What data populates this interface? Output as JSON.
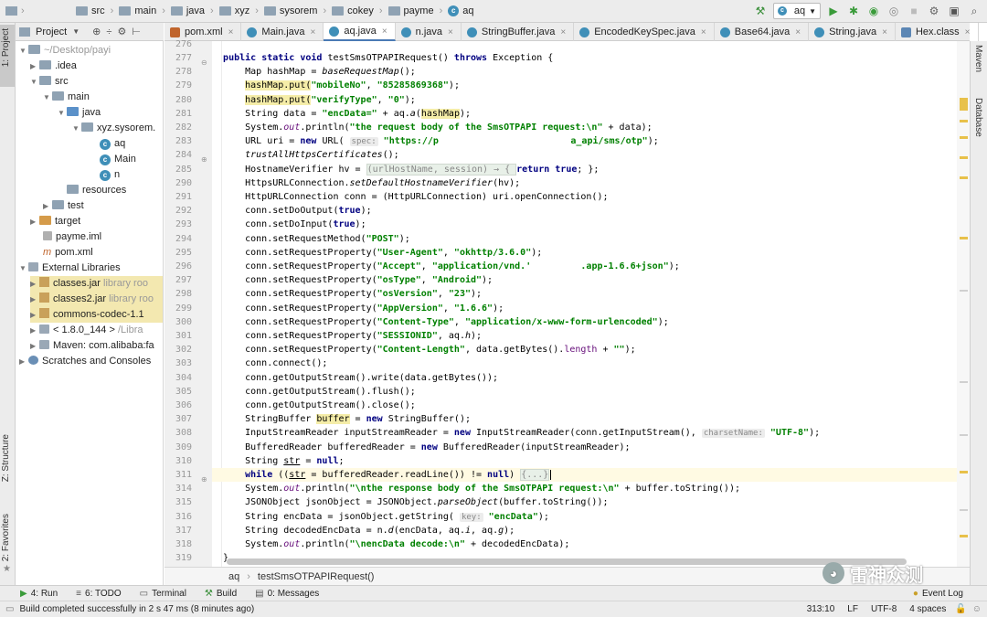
{
  "navbar": {
    "breadcrumbs": [
      {
        "label": "src",
        "icon": "folder-icon"
      },
      {
        "label": "main",
        "icon": "folder-icon"
      },
      {
        "label": "java",
        "icon": "folder-icon"
      },
      {
        "label": "xyz",
        "icon": "folder-icon"
      },
      {
        "label": "sysorem",
        "icon": "folder-icon"
      },
      {
        "label": "cokey",
        "icon": "folder-icon"
      },
      {
        "label": "payme",
        "icon": "folder-icon"
      },
      {
        "label": "aq",
        "icon": "class-icon"
      }
    ],
    "run_config": "aq"
  },
  "left_strip": {
    "project_tab": "1: Project",
    "structure_tab": "Z: Structure",
    "favorites_tab": "2: Favorites"
  },
  "right_strip": {
    "maven_tab": "Maven",
    "database_tab": "Database"
  },
  "project_panel": {
    "header": "Project",
    "tree": [
      {
        "label": "~/Desktop/payi",
        "indent": 0,
        "dim": true
      },
      {
        "label": ".idea",
        "indent": 1
      },
      {
        "label": "src",
        "indent": 1
      },
      {
        "label": "main",
        "indent": 2
      },
      {
        "label": "java",
        "indent": 3
      },
      {
        "label": "xyz.sysorem.",
        "indent": 4
      },
      {
        "label": "aq",
        "indent": 5
      },
      {
        "label": "Main",
        "indent": 5
      },
      {
        "label": "n",
        "indent": 5
      },
      {
        "label": "resources",
        "indent": 3
      },
      {
        "label": "test",
        "indent": 2
      },
      {
        "label": "target",
        "indent": 1
      },
      {
        "label": "payme.iml",
        "indent": 1
      },
      {
        "label": "pom.xml",
        "indent": 1
      },
      {
        "label": "External Libraries",
        "indent": 0
      },
      {
        "label": "classes.jar",
        "suffix": "library roo",
        "indent": 1
      },
      {
        "label": "classes2.jar",
        "suffix": "library roo",
        "indent": 1
      },
      {
        "label": "commons-codec-1.1",
        "indent": 1
      },
      {
        "label": "< 1.8.0_144 >",
        "suffix": "/Libra",
        "indent": 1
      },
      {
        "label": "Maven: com.alibaba:fa",
        "indent": 1
      },
      {
        "label": "Scratches and Consoles",
        "indent": 0
      }
    ]
  },
  "tabs": [
    {
      "label": "pom.xml",
      "kind": "xml"
    },
    {
      "label": "Main.java",
      "kind": "class"
    },
    {
      "label": "aq.java",
      "kind": "class",
      "active": true
    },
    {
      "label": "n.java",
      "kind": "class"
    },
    {
      "label": "StringBuffer.java",
      "kind": "class"
    },
    {
      "label": "EncodedKeySpec.java",
      "kind": "class"
    },
    {
      "label": "Base64.java",
      "kind": "class"
    },
    {
      "label": "String.java",
      "kind": "class"
    },
    {
      "label": "Hex.class",
      "kind": "cls"
    }
  ],
  "line_numbers": [
    "276",
    "277",
    "278",
    "279",
    "280",
    "281",
    "282",
    "283",
    "284",
    "285",
    "290",
    "291",
    "292",
    "293",
    "294",
    "295",
    "296",
    "297",
    "298",
    "299",
    "300",
    "301",
    "302",
    "303",
    "304",
    "305",
    "306",
    "307",
    "308",
    "309",
    "310",
    "311",
    "314",
    "315",
    "316",
    "317",
    "318",
    "319"
  ],
  "code": {
    "l277": [
      "public static void ",
      "testSmsOTPAPIRequest() ",
      "throws ",
      "Exception {"
    ],
    "l278": [
      "Map hashMap = ",
      "baseRequestMap",
      "();"
    ],
    "l279a": "hashMap.put(",
    "l279b": "\"mobileNo\"",
    "l279c": ", ",
    "l279d": "\"85285869368\"",
    "l279e": ");",
    "l280b": "\"verifyType\"",
    "l280d": "\"0\"",
    "l281": [
      "String data = ",
      "\"encData=\"",
      " + aq.",
      "a",
      "(",
      "hashMap",
      ");"
    ],
    "l282": [
      "System.",
      "out",
      ".println(",
      "\"the request body of the SmsOTPAPI request:\\n\"",
      " + data);"
    ],
    "l283": [
      "URL uri = ",
      "new ",
      "URL( ",
      "spec:",
      "\"https://p",
      "                        ",
      "a_api/sms/otp\"",
      ");"
    ],
    "l284": [
      "trustAllHttpsCertificates",
      "();"
    ],
    "l285": [
      "HostnameVerifier hv = ",
      "(urlHostName, session) → { ",
      "return true",
      "; };"
    ],
    "l290": [
      "HttpsURLConnection.",
      "setDefaultHostnameVerifier",
      "(hv);"
    ],
    "l291": [
      "HttpURLConnection conn = (HttpURLConnection) uri.openConnection();"
    ],
    "l292": [
      "conn.setDoOutput(",
      "true",
      ");"
    ],
    "l293": [
      "conn.setDoInput(",
      "true",
      ");"
    ],
    "l294": [
      "conn.setRequestMethod(",
      "\"POST\"",
      ");"
    ],
    "l295": [
      "conn.setRequestProperty(",
      "\"User-Agent\"",
      ", ",
      "\"okhttp/3.6.0\"",
      ");"
    ],
    "l296": [
      "conn.setRequestProperty(",
      "\"Accept\"",
      ", ",
      "\"application/vnd.'         .app-1.6.6+json\"",
      ");"
    ],
    "l297": [
      "conn.setRequestProperty(",
      "\"osType\"",
      ", ",
      "\"Android\"",
      ");"
    ],
    "l298": [
      "conn.setRequestProperty(",
      "\"osVersion\"",
      ", ",
      "\"23\"",
      ");"
    ],
    "l299": [
      "conn.setRequestProperty(",
      "\"AppVersion\"",
      ", ",
      "\"1.6.6\"",
      ");"
    ],
    "l300": [
      "conn.setRequestProperty(",
      "\"Content-Type\"",
      ", ",
      "\"application/x-www-form-urlencoded\"",
      ");"
    ],
    "l301": [
      "conn.setRequestProperty(",
      "\"SESSIONID\"",
      ", aq.",
      "h",
      ");"
    ],
    "l302": [
      "conn.setRequestProperty(",
      "\"Content-Length\"",
      ", data.getBytes().",
      "length",
      " + ",
      "\"\"",
      ");"
    ],
    "l303": [
      "conn.connect();"
    ],
    "l304": [
      "conn.getOutputStream().write(data.getBytes());"
    ],
    "l305": [
      "conn.getOutputStream().flush();"
    ],
    "l306": [
      "conn.getOutputStream().close();"
    ],
    "l307": [
      "StringBuffer ",
      "buffer",
      " = ",
      "new ",
      "StringBuffer();"
    ],
    "l308": [
      "InputStreamReader inputStreamReader = ",
      "new ",
      "InputStreamReader(conn.getInputStream(), ",
      "charsetName:",
      " ",
      "\"UTF-8\"",
      ");"
    ],
    "l309": [
      "BufferedReader bufferedReader = ",
      "new ",
      "BufferedReader(inputStreamReader);"
    ],
    "l310": [
      "String ",
      "str",
      " = ",
      "null",
      ";"
    ],
    "l311": [
      "while ",
      "((",
      "str",
      " = bufferedReader.readLine()) != ",
      "null",
      ") ",
      "{...}"
    ],
    "l314": [
      "System.",
      "out",
      ".println(",
      "\"\\nthe response body of the SmsOTPAPI request:\\n\"",
      " + buffer.toString());"
    ],
    "l315": [
      "JSONObject jsonObject = JSONObject.",
      "parseObject",
      "(buffer.toString());"
    ],
    "l316": [
      "String encData = jsonObject.getString( ",
      "key:",
      " ",
      "\"encData\"",
      ");"
    ],
    "l317": [
      "String decodedEncData = n.",
      "d",
      "(encData, aq.",
      "i",
      ", aq.",
      "g",
      ");"
    ],
    "l318": [
      "System.",
      "out",
      ".println(",
      "\"\\nencData decode:\\n\"",
      " + decodedEncData);"
    ],
    "l319": [
      "}"
    ]
  },
  "editor_breadcrumb": {
    "class": "aq",
    "method": "testSmsOTPAPIRequest()"
  },
  "tool_windows": [
    {
      "label": "4: Run"
    },
    {
      "label": "6: TODO"
    },
    {
      "label": "Terminal"
    },
    {
      "label": "Build"
    },
    {
      "label": "0: Messages"
    }
  ],
  "event_log": "Event Log",
  "status": {
    "message": "Build completed successfully in 2 s 47 ms (8 minutes ago)",
    "position": "313:10",
    "line_sep": "LF",
    "encoding": "UTF-8",
    "indent": "4 spaces"
  },
  "watermark": "雷神众测",
  "colors": {
    "keyword": "#000080",
    "string": "#008000",
    "field": "#660e7a",
    "accent": "#4a7ab5"
  }
}
